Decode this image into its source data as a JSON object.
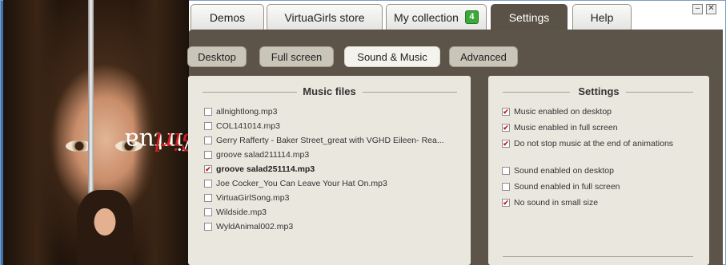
{
  "logo": {
    "text_a": "Virtua",
    "text_b": "Girl"
  },
  "tabs": [
    {
      "label": "Demos"
    },
    {
      "label": "VirtuaGirls store"
    },
    {
      "label": "My collection",
      "badge": "4"
    },
    {
      "label": "Settings",
      "active": true
    },
    {
      "label": "Help"
    }
  ],
  "window_buttons": {
    "minimize": "–",
    "close": "✕"
  },
  "subtabs": [
    {
      "label": "Desktop"
    },
    {
      "label": "Full screen"
    },
    {
      "label": "Sound & Music",
      "active": true
    },
    {
      "label": "Advanced"
    }
  ],
  "music_files": {
    "title": "Music files",
    "items": [
      {
        "name": "allnightlong.mp3",
        "checked": false
      },
      {
        "name": "COL141014.mp3",
        "checked": false
      },
      {
        "name": "Gerry Rafferty - Baker Street_great with VGHD Eileen- Rea...",
        "checked": false
      },
      {
        "name": "groove salad211114.mp3",
        "checked": false
      },
      {
        "name": "groove salad251114.mp3",
        "checked": true
      },
      {
        "name": "Joe Cocker_You Can Leave Your Hat On.mp3",
        "checked": false
      },
      {
        "name": "VirtuaGirlSong.mp3",
        "checked": false
      },
      {
        "name": "Wildside.mp3",
        "checked": false
      },
      {
        "name": "WyldAnimal002.mp3",
        "checked": false
      }
    ]
  },
  "settings": {
    "title": "Settings",
    "options": [
      {
        "label": "Music enabled on desktop",
        "checked": true
      },
      {
        "label": "Music enabled in full screen",
        "checked": true
      },
      {
        "label": "Do not stop music at the end of animations",
        "checked": true
      },
      {
        "label": "Sound enabled on desktop",
        "checked": false
      },
      {
        "label": "Sound enabled in full screen",
        "checked": false
      },
      {
        "label": "No sound in small size",
        "checked": true
      }
    ]
  },
  "colors": {
    "content_bg": "#5c5449",
    "panel_bg": "#e9e7de",
    "check_red": "#cc1a1a",
    "badge_green": "#3ca83a",
    "logo_red": "#d21f1f"
  },
  "icons": {
    "checkbox": "check-mark-icon",
    "badge": "count-badge",
    "minimize": "minimize-icon",
    "close": "close-icon"
  }
}
